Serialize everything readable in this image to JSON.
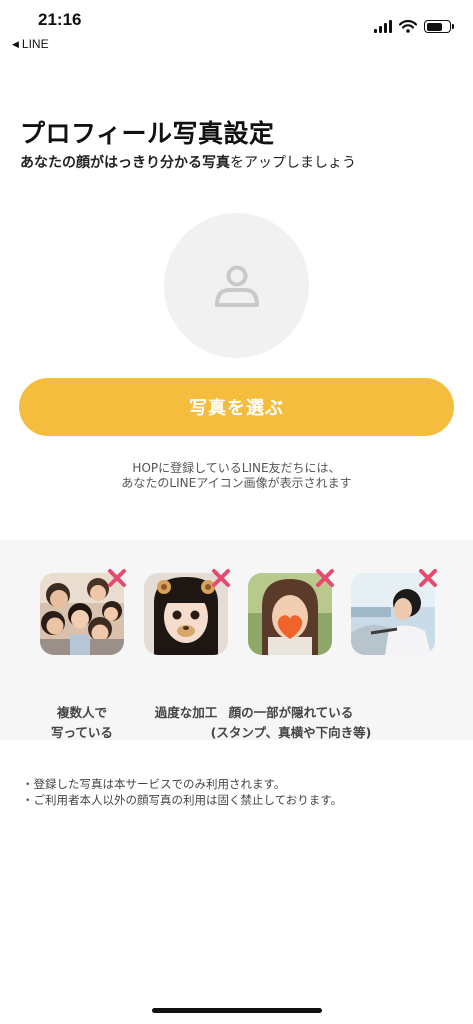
{
  "status_bar": {
    "time": "21:16",
    "back_app": "LINE",
    "icons": [
      "cellular-signal-icon",
      "wifi-icon",
      "battery-icon"
    ]
  },
  "header": {
    "title": "プロフィール写真設定",
    "subtitle_bold_1": "あなたの顔がはっきり分かる",
    "subtitle_bold_2": "写真",
    "subtitle_rest": "をアップしましょう"
  },
  "avatar": {
    "icon": "person-placeholder-icon"
  },
  "actions": {
    "select_photo_label": "写真を選ぶ"
  },
  "notice": {
    "line1": "HOPに登録しているLINE友だちには、",
    "line2": "あなたのLINEアイコン画像が表示されます"
  },
  "bad_examples": [
    {
      "label_line1": "複数人で",
      "label_line2": "写っている",
      "mark": "x-mark-icon"
    },
    {
      "label_line1": "過度な加工",
      "label_line2": "",
      "mark": "x-mark-icon"
    },
    {
      "label_line1": "顔の一部が隠れている",
      "label_line2": "(スタンプ、真横や下向き等)",
      "mark": "x-mark-icon"
    },
    {
      "label_line1": "",
      "label_line2": "",
      "mark": "x-mark-icon"
    }
  ],
  "footer_notes": {
    "note1": "・登録した写真は本サービスでのみ利用されます。",
    "note2": "・ご利用者本人以外の顔写真の利用は固く禁止しております。"
  },
  "colors": {
    "accent": "#f5bd3d",
    "x_mark": "#e84a6f",
    "panel_bg": "#f6f6f6",
    "avatar_bg": "#f1f1f1"
  }
}
